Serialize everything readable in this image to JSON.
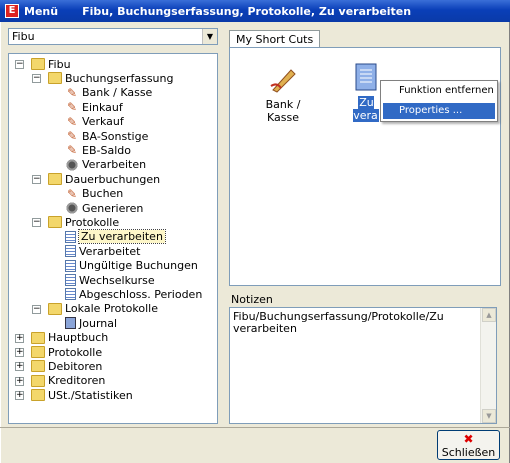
{
  "window": {
    "app_icon": "E",
    "menu_label": "Menü",
    "title": "Fibu, Buchungserfassung, Protokolle, Zu verarbeiten"
  },
  "module_select": {
    "value": "Fibu",
    "arrow": "▼"
  },
  "tree": {
    "nodes": [
      {
        "label": "Fibu",
        "icon": "folder-icon",
        "expander": "−"
      },
      {
        "label": "Buchungserfassung",
        "icon": "folder-icon",
        "expander": "−"
      },
      {
        "label": "Bank / Kasse",
        "icon": "pen-icon"
      },
      {
        "label": "Einkauf",
        "icon": "pen-icon"
      },
      {
        "label": "Verkauf",
        "icon": "pen-icon"
      },
      {
        "label": "BA-Sonstige",
        "icon": "pen-icon"
      },
      {
        "label": "EB-Saldo",
        "icon": "pen-icon"
      },
      {
        "label": "Verarbeiten",
        "icon": "gear-icon"
      },
      {
        "label": "Dauerbuchungen",
        "icon": "folder-icon",
        "expander": "−"
      },
      {
        "label": "Buchen",
        "icon": "pen-icon"
      },
      {
        "label": "Generieren",
        "icon": "gear-icon"
      },
      {
        "label": "Protokolle",
        "icon": "folder-icon",
        "expander": "−"
      },
      {
        "label": "Zu verarbeiten",
        "icon": "document-icon",
        "selected": true
      },
      {
        "label": "Verarbeitet",
        "icon": "document-icon"
      },
      {
        "label": "Ungültige Buchungen",
        "icon": "document-icon"
      },
      {
        "label": "Wechselkurse",
        "icon": "document-icon"
      },
      {
        "label": "Abgeschloss. Perioden",
        "icon": "document-icon"
      },
      {
        "label": "Lokale Protokolle",
        "icon": "folder-icon",
        "expander": "−"
      },
      {
        "label": "Journal",
        "icon": "book-icon"
      },
      {
        "label": "Hauptbuch",
        "icon": "folder-icon",
        "expander": "+"
      },
      {
        "label": "Protokolle",
        "icon": "folder-icon",
        "expander": "+"
      },
      {
        "label": "Debitoren",
        "icon": "folder-icon",
        "expander": "+"
      },
      {
        "label": "Kreditoren",
        "icon": "folder-icon",
        "expander": "+"
      },
      {
        "label": "USt./Statistiken",
        "icon": "folder-icon",
        "expander": "+"
      }
    ]
  },
  "shortcuts": {
    "tab_label": "My Short Cuts",
    "items": [
      {
        "label": "Bank / Kasse",
        "icon": "pen-icon"
      },
      {
        "label": "Zu verarbeiten",
        "icon": "document-icon",
        "visible_label": "Zu vera"
      }
    ]
  },
  "context_menu": {
    "items": [
      "Funktion entfernen",
      "Properties ..."
    ],
    "highlighted": 1
  },
  "notes": {
    "label": "Notizen",
    "text": "Fibu/Buchungserfassung/Protokolle/Zu verarbeiten"
  },
  "close_button": {
    "label": "Schließen",
    "icon": "close-x-icon"
  },
  "colors": {
    "titlebar": "#0a3fb8",
    "selection": "#316ac5",
    "window_bg": "#ece9d8"
  }
}
